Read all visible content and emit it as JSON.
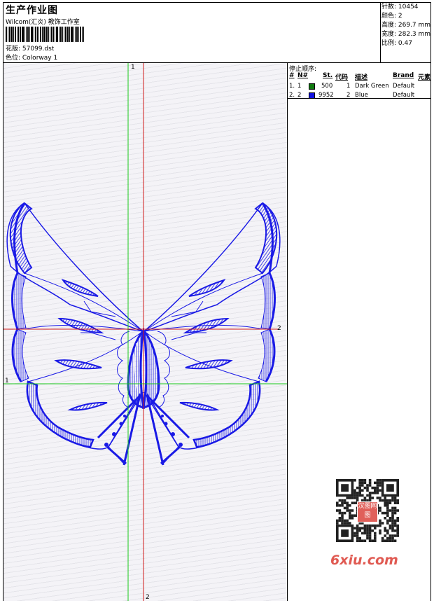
{
  "header": {
    "title": "生产作业图",
    "subtitle": "Wilcom(汇炎) 教饰工作室",
    "design_line": "花版: 57099.dst",
    "colorway_line": "色位: Colorway 1"
  },
  "stats": {
    "stitches": "针数: 10454",
    "colors": "颜色: 2",
    "height": "高度: 269.7 mm",
    "width": "宽度: 282.3 mm",
    "ratio": "比例: 0.47"
  },
  "stop_sequence": {
    "title": "停止顺序:",
    "headers": {
      "num": "#",
      "n": "N#",
      "st": "St.",
      "code": "代码",
      "desc": "描述",
      "brand": "Brand",
      "element": "元素"
    },
    "rows": [
      {
        "num": "1.",
        "n": "1",
        "st": "500",
        "code": "1",
        "desc": "Dark Green",
        "brand": "Default",
        "color": "#0f7a0f"
      },
      {
        "num": "2.",
        "n": "2",
        "st": "9952",
        "code": "2",
        "desc": "Blue",
        "brand": "Default",
        "color": "#1010e0"
      }
    ]
  },
  "axes": {
    "green_label_top": "1",
    "green_label_left": "1",
    "red_label_right": "2",
    "red_label_bottom": "2",
    "green_color": "#19c819",
    "red_color": "#d01818"
  },
  "design_color": "#1a1ae6",
  "watermark": {
    "text": "6xiu.com",
    "seal": "汉图网图"
  }
}
